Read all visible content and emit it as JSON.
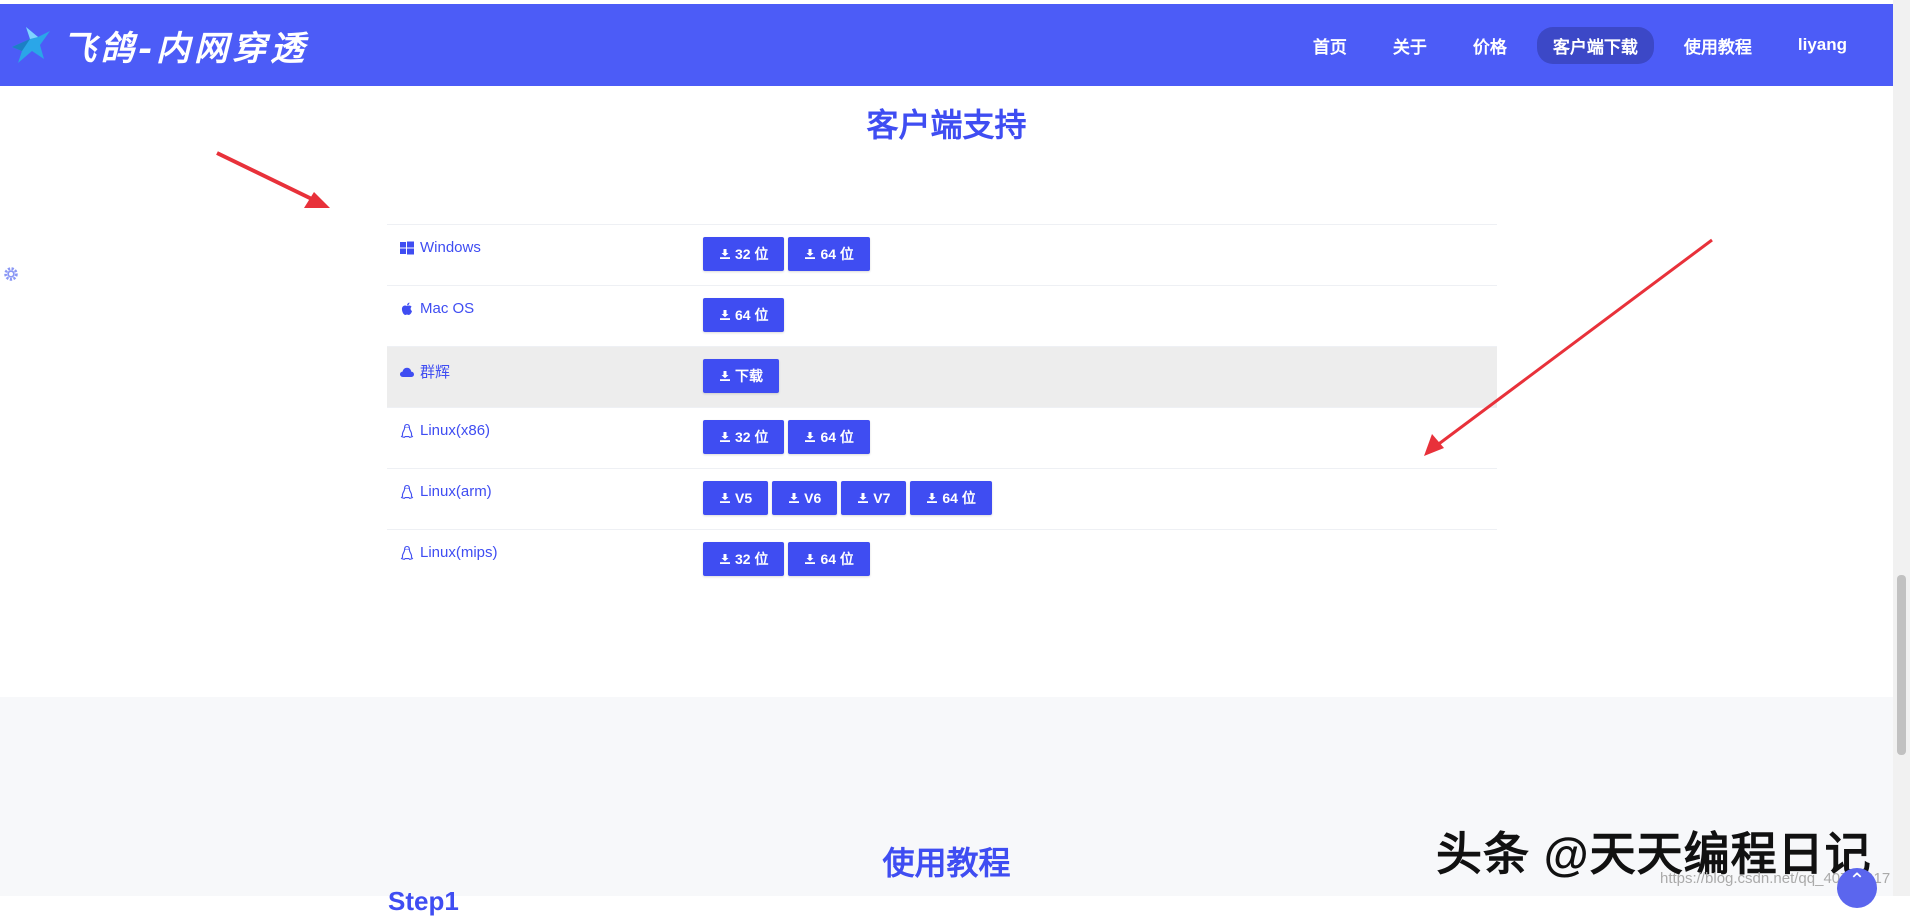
{
  "brand": {
    "name": "飞鸽-内网穿透",
    "logo_icon": "bird-logo-icon"
  },
  "nav": {
    "items": [
      {
        "label": "首页",
        "active": false
      },
      {
        "label": "关于",
        "active": false
      },
      {
        "label": "价格",
        "active": false
      },
      {
        "label": "客户端下载",
        "active": true
      },
      {
        "label": "使用教程",
        "active": false
      },
      {
        "label": "liyang",
        "active": false
      }
    ]
  },
  "client_section": {
    "title": "客户端支持",
    "rows": [
      {
        "os": "Windows",
        "icon": "windows-icon",
        "buttons": [
          "32 位",
          "64 位"
        ]
      },
      {
        "os": "Mac OS",
        "icon": "apple-icon",
        "buttons": [
          "64 位"
        ]
      },
      {
        "os": "群辉",
        "icon": "cloud-icon",
        "buttons": [
          "下载"
        ],
        "highlight": true
      },
      {
        "os": "Linux(x86)",
        "icon": "linux-icon",
        "buttons": [
          "32 位",
          "64 位"
        ]
      },
      {
        "os": "Linux(arm)",
        "icon": "linux-icon",
        "buttons": [
          "V5",
          "V6",
          "V7",
          "64 位"
        ]
      },
      {
        "os": "Linux(mips)",
        "icon": "linux-icon",
        "buttons": [
          "32 位",
          "64 位"
        ]
      }
    ]
  },
  "tutorial_section": {
    "title": "使用教程",
    "step_label": "Step1"
  },
  "watermark": {
    "text": "头条 @天天编程日记",
    "url": "https://blog.csdn.net/qq_40739917"
  },
  "colors": {
    "primary": "#4c5cf7",
    "button": "#3f4df2",
    "arrow": "#e8313a",
    "highlight_row": "#ededed"
  }
}
